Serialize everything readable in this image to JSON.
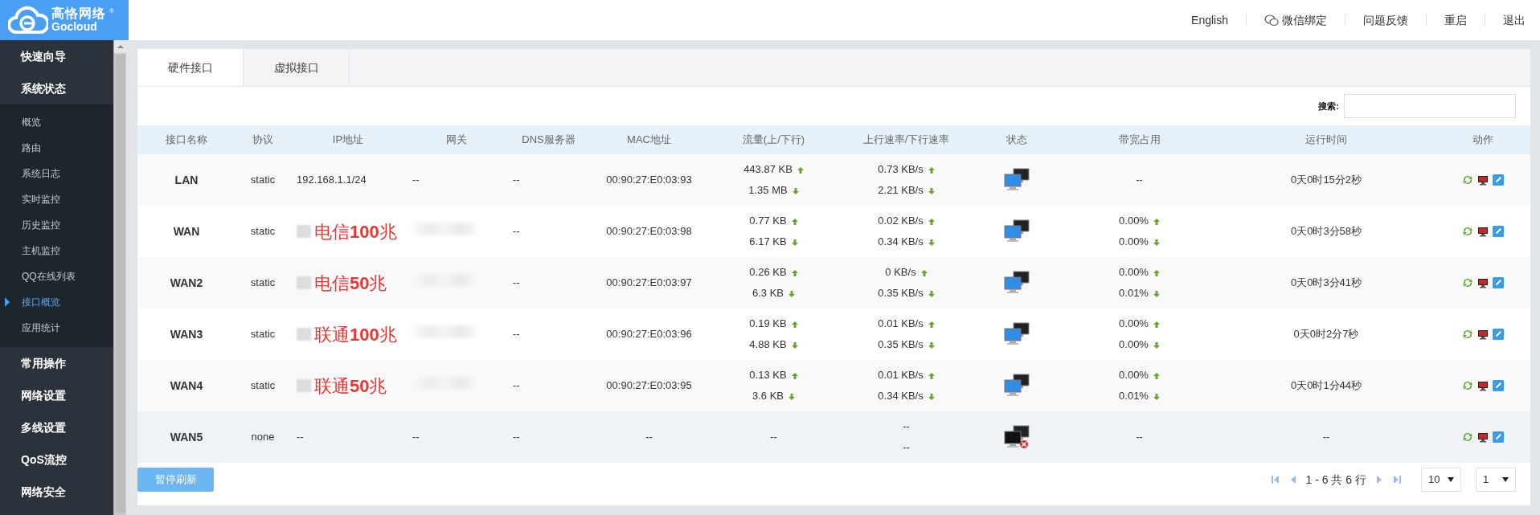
{
  "logo": {
    "name": "高恪网络",
    "brand": "Gocloud",
    "mark": "®"
  },
  "top_links": [
    {
      "label": "English",
      "kind": "text"
    },
    {
      "label": "微信绑定",
      "kind": "wechat"
    },
    {
      "label": "问题反馈",
      "kind": "text"
    },
    {
      "label": "重启",
      "kind": "text"
    },
    {
      "label": "退出",
      "kind": "text"
    }
  ],
  "sidebar": {
    "items": [
      {
        "label": "快速向导"
      },
      {
        "label": "系统状态",
        "expanded": true,
        "children": [
          {
            "label": "概览",
            "selected": false
          },
          {
            "label": "路由",
            "selected": false
          },
          {
            "label": "系统日志",
            "selected": false
          },
          {
            "label": "实时监控",
            "selected": false
          },
          {
            "label": "历史监控",
            "selected": false
          },
          {
            "label": "主机监控",
            "selected": false
          },
          {
            "label": "QQ在线列表",
            "selected": false
          },
          {
            "label": "接口概览",
            "selected": true
          },
          {
            "label": "应用统计",
            "selected": false
          }
        ]
      },
      {
        "label": "常用操作"
      },
      {
        "label": "网络设置"
      },
      {
        "label": "多线设置"
      },
      {
        "label": "QoS流控"
      },
      {
        "label": "网络安全"
      }
    ]
  },
  "tabs": [
    {
      "label": "硬件接口",
      "selected": true
    },
    {
      "label": "虚拟接口",
      "selected": false
    }
  ],
  "search": {
    "label": "搜索:"
  },
  "table": {
    "columns": [
      "接口名称",
      "协议",
      "IP地址",
      "网关",
      "DNS服务器",
      "MAC地址",
      "流量(上/下行)",
      "上行速率/下行速率",
      "状态",
      "带宽占用",
      "运行时间",
      "动作"
    ],
    "rows": [
      {
        "name": "LAN",
        "protocol": "static",
        "ip": "192.168.1.1/24",
        "gateway": "--",
        "dns": "--",
        "mac": "00:90:27:E0:03:93",
        "traffic": [
          {
            "value": "443.87 KB",
            "kind": "up"
          },
          {
            "value": "1.35 MB",
            "kind": "down"
          }
        ],
        "rate": [
          {
            "value": "0.73 KB/s",
            "kind": "up"
          },
          {
            "value": "2.21 KB/s",
            "kind": "down"
          }
        ],
        "connected": true,
        "bandwidth": [
          {
            "value": "--",
            "kind": "plain"
          }
        ],
        "uptime": "0天0时15分2秒"
      },
      {
        "name": "WAN",
        "protocol": "static",
        "ip_redacted": true,
        "annotation": "电信**100**兆",
        "gateway_redacted": true,
        "dns": "--",
        "mac": "00:90:27:E0:03:98",
        "traffic": [
          {
            "value": "0.77 KB",
            "kind": "up"
          },
          {
            "value": "6.17 KB",
            "kind": "down"
          }
        ],
        "rate": [
          {
            "value": "0.02 KB/s",
            "kind": "up"
          },
          {
            "value": "0.34 KB/s",
            "kind": "down"
          }
        ],
        "connected": true,
        "bandwidth": [
          {
            "value": "0.00%",
            "kind": "up"
          },
          {
            "value": "0.00%",
            "kind": "down"
          }
        ],
        "uptime": "0天0时3分58秒"
      },
      {
        "name": "WAN2",
        "protocol": "static",
        "ip_redacted": true,
        "annotation": "电信**50**兆",
        "gateway_redacted": true,
        "dns": "--",
        "mac": "00:90:27:E0:03:97",
        "traffic": [
          {
            "value": "0.26 KB",
            "kind": "up"
          },
          {
            "value": "6.3 KB",
            "kind": "down"
          }
        ],
        "rate": [
          {
            "value": "0 KB/s",
            "kind": "up"
          },
          {
            "value": "0.35 KB/s",
            "kind": "down"
          }
        ],
        "connected": true,
        "bandwidth": [
          {
            "value": "0.00%",
            "kind": "up"
          },
          {
            "value": "0.01%",
            "kind": "down"
          }
        ],
        "uptime": "0天0时3分41秒"
      },
      {
        "name": "WAN3",
        "protocol": "static",
        "ip_redacted": true,
        "annotation": "联通**100**兆",
        "gateway_redacted": true,
        "dns": "--",
        "mac": "00:90:27:E0:03:96",
        "traffic": [
          {
            "value": "0.19 KB",
            "kind": "up"
          },
          {
            "value": "4.88 KB",
            "kind": "down"
          }
        ],
        "rate": [
          {
            "value": "0.01 KB/s",
            "kind": "up"
          },
          {
            "value": "0.35 KB/s",
            "kind": "down"
          }
        ],
        "connected": true,
        "bandwidth": [
          {
            "value": "0.00%",
            "kind": "up"
          },
          {
            "value": "0.00%",
            "kind": "down"
          }
        ],
        "uptime": "0天0时2分7秒"
      },
      {
        "name": "WAN4",
        "protocol": "static",
        "ip_redacted": true,
        "annotation": "联通**50**兆",
        "gateway_redacted": true,
        "dns": "--",
        "mac": "00:90:27:E0:03:95",
        "traffic": [
          {
            "value": "0.13 KB",
            "kind": "up"
          },
          {
            "value": "3.6 KB",
            "kind": "down"
          }
        ],
        "rate": [
          {
            "value": "0.01 KB/s",
            "kind": "up"
          },
          {
            "value": "0.34 KB/s",
            "kind": "down"
          }
        ],
        "connected": true,
        "bandwidth": [
          {
            "value": "0.00%",
            "kind": "up"
          },
          {
            "value": "0.01%",
            "kind": "down"
          }
        ],
        "uptime": "0天0时1分44秒"
      },
      {
        "name": "WAN5",
        "protocol": "none",
        "ip": "--",
        "gateway": "--",
        "dns": "--",
        "mac": "--",
        "traffic": [
          {
            "value": "--",
            "kind": "plain"
          }
        ],
        "rate": [
          {
            "value": "--",
            "kind": "plain"
          },
          {
            "value": "--",
            "kind": "plain"
          }
        ],
        "connected": false,
        "bandwidth": [
          {
            "value": "--",
            "kind": "plain"
          }
        ],
        "uptime": "--",
        "highlighted": true
      }
    ]
  },
  "pause_button": "暂停刷新",
  "pagination": {
    "summary": "1 - 6 共 6 行",
    "page_size": "10",
    "page": "1"
  }
}
